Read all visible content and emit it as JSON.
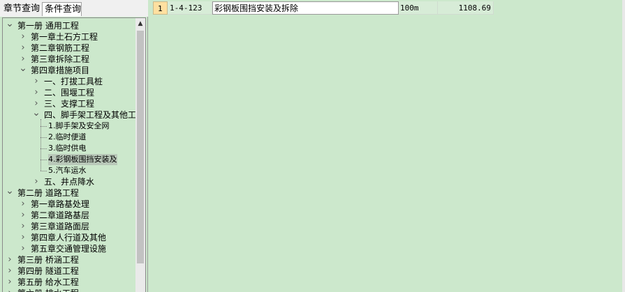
{
  "tabs": [
    "章节查询",
    "条件查询"
  ],
  "tree": [
    {
      "label": "第一册 通用工程",
      "expanded": true
    },
    {
      "label": "第一章土石方工程",
      "expanded": false
    },
    {
      "label": "第二章钢筋工程",
      "expanded": false
    },
    {
      "label": "第三章拆除工程",
      "expanded": false
    },
    {
      "label": "第四章措施项目",
      "expanded": true
    },
    {
      "label": "一、打拔工具桩",
      "expanded": false
    },
    {
      "label": "二、围堰工程",
      "expanded": false
    },
    {
      "label": "三、支撑工程",
      "expanded": false
    },
    {
      "label": "四、脚手架工程及其他工",
      "expanded": true
    },
    {
      "label": "1.脚手架及安全网"
    },
    {
      "label": "2.临时便道"
    },
    {
      "label": "3.临时供电"
    },
    {
      "label": "4.彩钢板围挡安装及",
      "selected": true
    },
    {
      "label": "5.汽车运水"
    },
    {
      "label": "五、井点降水",
      "expanded": false
    },
    {
      "label": "第二册 道路工程",
      "expanded": true
    },
    {
      "label": "第一章路基处理",
      "expanded": false
    },
    {
      "label": "第二章道路基层",
      "expanded": false
    },
    {
      "label": "第三章道路面层",
      "expanded": false
    },
    {
      "label": "第四章人行道及其他",
      "expanded": false
    },
    {
      "label": "第五章交通管理设施",
      "expanded": false
    },
    {
      "label": "第三册 桥涵工程",
      "expanded": false
    },
    {
      "label": "第四册 隧道工程",
      "expanded": false
    },
    {
      "label": "第五册 给水工程",
      "expanded": false
    },
    {
      "label": "第六册 排水工程",
      "expanded": false
    }
  ],
  "grid": {
    "rows": [
      {
        "index": "1",
        "code": "1-4-123",
        "name": "彩钢板围挡安装及拆除",
        "unit": "100m",
        "price": "1108.69"
      }
    ]
  },
  "icons": {
    "expanded": "chevron-down-icon",
    "collapsed": "chevron-right-icon",
    "scroll_up": "arrow-up-icon"
  }
}
